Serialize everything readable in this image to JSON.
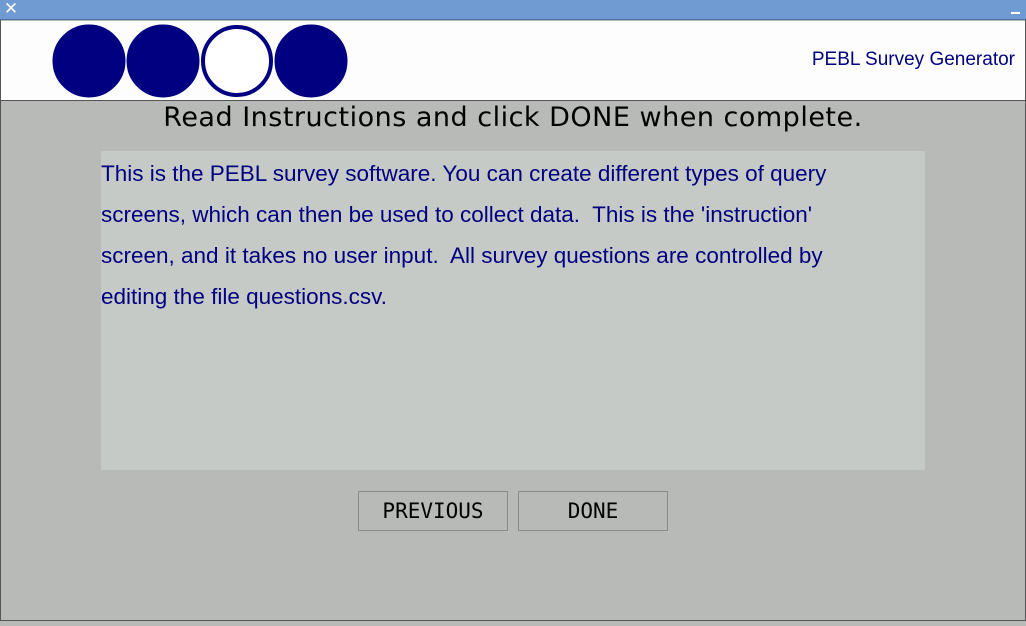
{
  "window": {
    "close_glyph": "✕"
  },
  "header": {
    "app_name": "PEBL Survey Generator",
    "logo_colors": {
      "fill": "#000080",
      "empty": "#ffffff",
      "stroke": "#000080"
    },
    "logo_circles": [
      "filled",
      "filled",
      "empty",
      "filled"
    ]
  },
  "main": {
    "title": "Read Instructions and click DONE when complete.",
    "instruction_text": "This is the PEBL survey software. You can create different types of query\nscreens, which can then be used to collect data.  This is the 'instruction'\nscreen, and it takes no user input.  All survey questions are controlled by\nediting the file questions.csv."
  },
  "buttons": {
    "previous_label": "PREVIOUS",
    "done_label": "DONE"
  },
  "icons": {
    "close": "close-icon",
    "minimize": "minimize-icon"
  }
}
